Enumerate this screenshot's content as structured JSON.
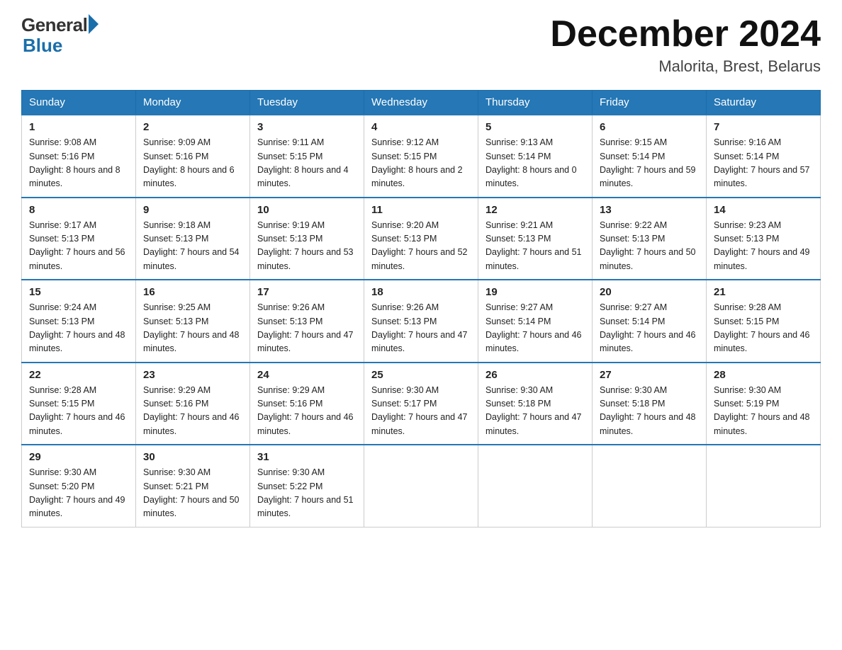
{
  "header": {
    "logo_general": "General",
    "logo_blue": "Blue",
    "month_title": "December 2024",
    "location": "Malorita, Brest, Belarus"
  },
  "days_of_week": [
    "Sunday",
    "Monday",
    "Tuesday",
    "Wednesday",
    "Thursday",
    "Friday",
    "Saturday"
  ],
  "weeks": [
    [
      {
        "day": "1",
        "sunrise": "9:08 AM",
        "sunset": "5:16 PM",
        "daylight": "8 hours and 8 minutes."
      },
      {
        "day": "2",
        "sunrise": "9:09 AM",
        "sunset": "5:16 PM",
        "daylight": "8 hours and 6 minutes."
      },
      {
        "day": "3",
        "sunrise": "9:11 AM",
        "sunset": "5:15 PM",
        "daylight": "8 hours and 4 minutes."
      },
      {
        "day": "4",
        "sunrise": "9:12 AM",
        "sunset": "5:15 PM",
        "daylight": "8 hours and 2 minutes."
      },
      {
        "day": "5",
        "sunrise": "9:13 AM",
        "sunset": "5:14 PM",
        "daylight": "8 hours and 0 minutes."
      },
      {
        "day": "6",
        "sunrise": "9:15 AM",
        "sunset": "5:14 PM",
        "daylight": "7 hours and 59 minutes."
      },
      {
        "day": "7",
        "sunrise": "9:16 AM",
        "sunset": "5:14 PM",
        "daylight": "7 hours and 57 minutes."
      }
    ],
    [
      {
        "day": "8",
        "sunrise": "9:17 AM",
        "sunset": "5:13 PM",
        "daylight": "7 hours and 56 minutes."
      },
      {
        "day": "9",
        "sunrise": "9:18 AM",
        "sunset": "5:13 PM",
        "daylight": "7 hours and 54 minutes."
      },
      {
        "day": "10",
        "sunrise": "9:19 AM",
        "sunset": "5:13 PM",
        "daylight": "7 hours and 53 minutes."
      },
      {
        "day": "11",
        "sunrise": "9:20 AM",
        "sunset": "5:13 PM",
        "daylight": "7 hours and 52 minutes."
      },
      {
        "day": "12",
        "sunrise": "9:21 AM",
        "sunset": "5:13 PM",
        "daylight": "7 hours and 51 minutes."
      },
      {
        "day": "13",
        "sunrise": "9:22 AM",
        "sunset": "5:13 PM",
        "daylight": "7 hours and 50 minutes."
      },
      {
        "day": "14",
        "sunrise": "9:23 AM",
        "sunset": "5:13 PM",
        "daylight": "7 hours and 49 minutes."
      }
    ],
    [
      {
        "day": "15",
        "sunrise": "9:24 AM",
        "sunset": "5:13 PM",
        "daylight": "7 hours and 48 minutes."
      },
      {
        "day": "16",
        "sunrise": "9:25 AM",
        "sunset": "5:13 PM",
        "daylight": "7 hours and 48 minutes."
      },
      {
        "day": "17",
        "sunrise": "9:26 AM",
        "sunset": "5:13 PM",
        "daylight": "7 hours and 47 minutes."
      },
      {
        "day": "18",
        "sunrise": "9:26 AM",
        "sunset": "5:13 PM",
        "daylight": "7 hours and 47 minutes."
      },
      {
        "day": "19",
        "sunrise": "9:27 AM",
        "sunset": "5:14 PM",
        "daylight": "7 hours and 46 minutes."
      },
      {
        "day": "20",
        "sunrise": "9:27 AM",
        "sunset": "5:14 PM",
        "daylight": "7 hours and 46 minutes."
      },
      {
        "day": "21",
        "sunrise": "9:28 AM",
        "sunset": "5:15 PM",
        "daylight": "7 hours and 46 minutes."
      }
    ],
    [
      {
        "day": "22",
        "sunrise": "9:28 AM",
        "sunset": "5:15 PM",
        "daylight": "7 hours and 46 minutes."
      },
      {
        "day": "23",
        "sunrise": "9:29 AM",
        "sunset": "5:16 PM",
        "daylight": "7 hours and 46 minutes."
      },
      {
        "day": "24",
        "sunrise": "9:29 AM",
        "sunset": "5:16 PM",
        "daylight": "7 hours and 46 minutes."
      },
      {
        "day": "25",
        "sunrise": "9:30 AM",
        "sunset": "5:17 PM",
        "daylight": "7 hours and 47 minutes."
      },
      {
        "day": "26",
        "sunrise": "9:30 AM",
        "sunset": "5:18 PM",
        "daylight": "7 hours and 47 minutes."
      },
      {
        "day": "27",
        "sunrise": "9:30 AM",
        "sunset": "5:18 PM",
        "daylight": "7 hours and 48 minutes."
      },
      {
        "day": "28",
        "sunrise": "9:30 AM",
        "sunset": "5:19 PM",
        "daylight": "7 hours and 48 minutes."
      }
    ],
    [
      {
        "day": "29",
        "sunrise": "9:30 AM",
        "sunset": "5:20 PM",
        "daylight": "7 hours and 49 minutes."
      },
      {
        "day": "30",
        "sunrise": "9:30 AM",
        "sunset": "5:21 PM",
        "daylight": "7 hours and 50 minutes."
      },
      {
        "day": "31",
        "sunrise": "9:30 AM",
        "sunset": "5:22 PM",
        "daylight": "7 hours and 51 minutes."
      },
      null,
      null,
      null,
      null
    ]
  ]
}
